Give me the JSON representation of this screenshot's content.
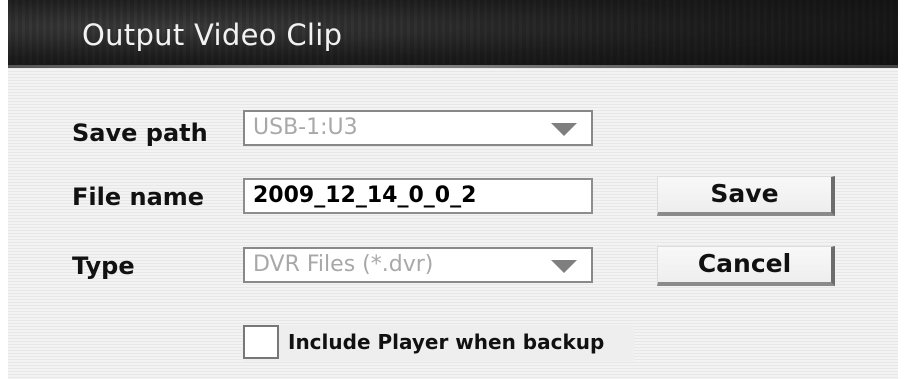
{
  "dialog": {
    "title": "Output Video Clip"
  },
  "form": {
    "save_path": {
      "label": "Save path",
      "value": "USB-1:U3"
    },
    "file_name": {
      "label": "File name",
      "value": "2009_12_14_0_0_2"
    },
    "type": {
      "label": "Type",
      "value": "DVR Files (*.dvr)"
    },
    "include_player": {
      "label": "Include Player when backup",
      "checked": false
    }
  },
  "buttons": {
    "save": "Save",
    "cancel": "Cancel"
  },
  "icons": {
    "dropdown": "chevron-down-icon"
  }
}
